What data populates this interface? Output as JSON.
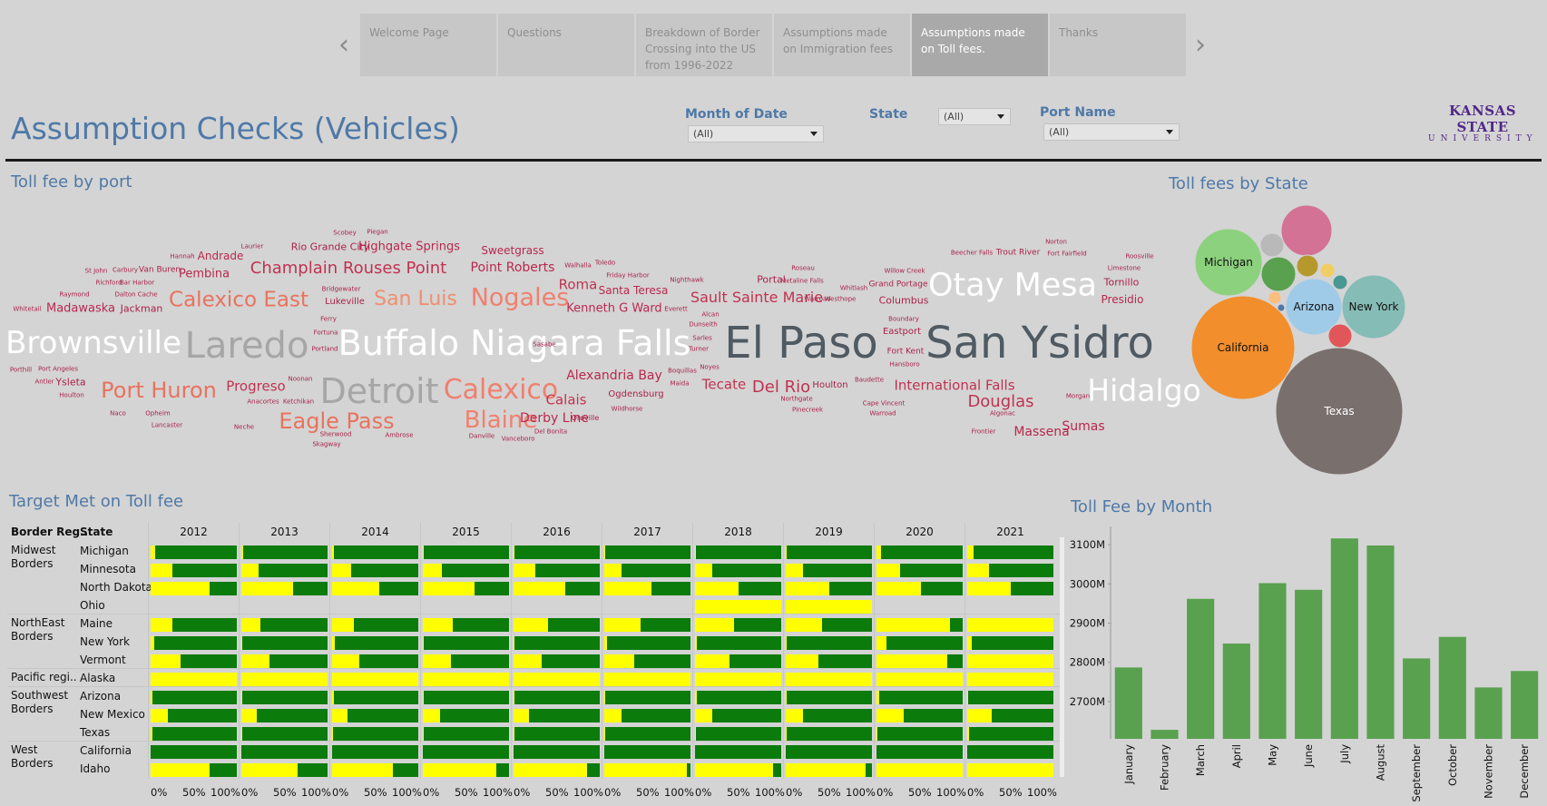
{
  "story": {
    "prev_arrow": "‹",
    "next_arrow": "›",
    "tabs": [
      {
        "label": "Welcome Page",
        "active": false
      },
      {
        "label": "Questions",
        "active": false
      },
      {
        "label": "Breakdown of Border Crossing into the US from 1996-2022",
        "active": false
      },
      {
        "label": "Assumptions made on Immigration fees",
        "active": false
      },
      {
        "label": "Assumptions made on Toll fees.",
        "active": true
      },
      {
        "label": "Thanks",
        "active": false
      }
    ]
  },
  "header": {
    "title": "Assumption Checks (Vehicles)",
    "logo_line1": "KANSAS STATE",
    "logo_line2": "UNIVERSITY"
  },
  "filters": {
    "month_label": "Month of Date",
    "month_value": "(All)",
    "state_label": "State",
    "state_value": "(All)",
    "port_label": "Port Name",
    "port_value": "(All)"
  },
  "wordcloud": {
    "title": "Toll fee by port",
    "words": [
      {
        "t": "Scobey",
        "s": 7,
        "c": "#a9224a"
      },
      {
        "t": "Piegan",
        "s": 7,
        "c": "#a9224a"
      },
      {
        "t": "Laurier",
        "s": 7,
        "c": "#a9224a"
      },
      {
        "t": "Rio Grande City",
        "s": 11,
        "c": "#a9224a"
      },
      {
        "t": "Highgate Springs",
        "s": 13,
        "c": "#b8284e"
      },
      {
        "t": "Sweetgrass",
        "s": 12,
        "c": "#b8284e"
      },
      {
        "t": "Hannah",
        "s": 7,
        "c": "#a9224a"
      },
      {
        "t": "Andrade",
        "s": 12,
        "c": "#b8284e"
      },
      {
        "t": "St John",
        "s": 7,
        "c": "#a9224a"
      },
      {
        "t": "Carbury",
        "s": 7,
        "c": "#a9224a"
      },
      {
        "t": "Van Buren",
        "s": 9,
        "c": "#a9224a"
      },
      {
        "t": "Pembina",
        "s": 13,
        "c": "#b8284e"
      },
      {
        "t": "Champlain Rouses Point",
        "s": 18,
        "c": "#bf3350"
      },
      {
        "t": "Point Roberts",
        "s": 14,
        "c": "#b8284e"
      },
      {
        "t": "Walhalla",
        "s": 7,
        "c": "#a9224a"
      },
      {
        "t": "Toledo",
        "s": 7,
        "c": "#a9224a"
      },
      {
        "t": "Friday Harbor",
        "s": 7,
        "c": "#a9224a"
      },
      {
        "t": "Roma",
        "s": 15,
        "c": "#bf3350"
      },
      {
        "t": "Santa Teresa",
        "s": 12,
        "c": "#b8284e"
      },
      {
        "t": "Richford",
        "s": 7,
        "c": "#a9224a"
      },
      {
        "t": "Bar Harbor",
        "s": 7,
        "c": "#a9224a"
      },
      {
        "t": "Raymond",
        "s": 7,
        "c": "#a9224a"
      },
      {
        "t": "Dalton Cache",
        "s": 7,
        "c": "#a9224a"
      },
      {
        "t": "Calexico East",
        "s": 23,
        "c": "#e8735e"
      },
      {
        "t": "Bridgewater",
        "s": 7,
        "c": "#a9224a"
      },
      {
        "t": "Lukeville",
        "s": 10,
        "c": "#a9224a"
      },
      {
        "t": "San Luis",
        "s": 22,
        "c": "#ef8f6f"
      },
      {
        "t": "Nogales",
        "s": 27,
        "c": "#ef8070"
      },
      {
        "t": "Whitetail",
        "s": 7,
        "c": "#a9224a"
      },
      {
        "t": "Madawaska",
        "s": 13,
        "c": "#b8284e"
      },
      {
        "t": "Jackman",
        "s": 11,
        "c": "#a9224a"
      },
      {
        "t": "Kenneth G Ward",
        "s": 13,
        "c": "#b8284e"
      },
      {
        "t": "Everett",
        "s": 7,
        "c": "#a9224a"
      },
      {
        "t": "Ferry",
        "s": 7,
        "c": "#a9224a"
      },
      {
        "t": "Brownsville",
        "s": 34,
        "c": "#ffffff"
      },
      {
        "t": "Fortuna",
        "s": 7,
        "c": "#a9224a"
      },
      {
        "t": "Portland",
        "s": 7,
        "c": "#a9224a"
      },
      {
        "t": "Laredo",
        "s": 40,
        "c": "#a6a6a6"
      },
      {
        "t": "Buffalo Niagara Falls",
        "s": 38,
        "c": "#ffffff"
      },
      {
        "t": "El Paso",
        "s": 48,
        "c": "#4f5a62"
      },
      {
        "t": "San Ysidro",
        "s": 48,
        "c": "#4f5a62"
      },
      {
        "t": "Nighthawk",
        "s": 7,
        "c": "#a9224a"
      },
      {
        "t": "Alcan",
        "s": 7,
        "c": "#a9224a"
      },
      {
        "t": "Dunseith",
        "s": 7,
        "c": "#a9224a"
      },
      {
        "t": "Sault Sainte Marie",
        "s": 16,
        "c": "#bf3350"
      },
      {
        "t": "Portal",
        "s": 11,
        "c": "#a9224a"
      },
      {
        "t": "Roseau",
        "s": 7,
        "c": "#a9224a"
      },
      {
        "t": "Metaline Falls",
        "s": 7,
        "c": "#a9224a"
      },
      {
        "t": "Whitlash",
        "s": 7,
        "c": "#a9224a"
      },
      {
        "t": "Warroad",
        "s": 7,
        "c": "#a9224a"
      },
      {
        "t": "Westhope",
        "s": 7,
        "c": "#a9224a"
      },
      {
        "t": "Willow Creek",
        "s": 7,
        "c": "#a9224a"
      },
      {
        "t": "Grand Portage",
        "s": 9,
        "c": "#a9224a"
      },
      {
        "t": "Columbus",
        "s": 11,
        "c": "#a9224a"
      },
      {
        "t": "Otay Mesa",
        "s": 35,
        "c": "#ffffff"
      },
      {
        "t": "Beecher Falls",
        "s": 7,
        "c": "#a9224a"
      },
      {
        "t": "Trout River",
        "s": 9,
        "c": "#a9224a"
      },
      {
        "t": "Norton",
        "s": 7,
        "c": "#a9224a"
      },
      {
        "t": "Fort Fairfield",
        "s": 7,
        "c": "#a9224a"
      },
      {
        "t": "Roosville",
        "s": 7,
        "c": "#a9224a"
      },
      {
        "t": "Limestone",
        "s": 7,
        "c": "#a9224a"
      },
      {
        "t": "Tornillo",
        "s": 11,
        "c": "#a9224a"
      },
      {
        "t": "Presidio",
        "s": 12,
        "c": "#b8284e"
      },
      {
        "t": "Boundary",
        "s": 7,
        "c": "#a9224a"
      },
      {
        "t": "Eastport",
        "s": 10,
        "c": "#a9224a"
      },
      {
        "t": "Fort Kent",
        "s": 9,
        "c": "#a9224a"
      },
      {
        "t": "Hansboro",
        "s": 7,
        "c": "#a9224a"
      },
      {
        "t": "Porthill",
        "s": 7,
        "c": "#a9224a"
      },
      {
        "t": "Port Angeles",
        "s": 7,
        "c": "#a9224a"
      },
      {
        "t": "Antler",
        "s": 7,
        "c": "#a9224a"
      },
      {
        "t": "Ysleta",
        "s": 11,
        "c": "#a9224a"
      },
      {
        "t": "Houlton",
        "s": 7,
        "c": "#a9224a"
      },
      {
        "t": "Port Huron",
        "s": 24,
        "c": "#e8735e"
      },
      {
        "t": "Progreso",
        "s": 15,
        "c": "#bf3350"
      },
      {
        "t": "Noonan",
        "s": 7,
        "c": "#a9224a"
      },
      {
        "t": "Anacortes",
        "s": 7,
        "c": "#a9224a"
      },
      {
        "t": "Ketchikan",
        "s": 7,
        "c": "#a9224a"
      },
      {
        "t": "Detroit",
        "s": 38,
        "c": "#a6a6a6"
      },
      {
        "t": "Calexico",
        "s": 30,
        "c": "#ef8070"
      },
      {
        "t": "Alexandria Bay",
        "s": 14,
        "c": "#b8284e"
      },
      {
        "t": "Calais",
        "s": 15,
        "c": "#bf3350"
      },
      {
        "t": "Ogdensburg",
        "s": 10,
        "c": "#a9224a"
      },
      {
        "t": "Wildhorse",
        "s": 7,
        "c": "#a9224a"
      },
      {
        "t": "Boquillas",
        "s": 7,
        "c": "#a9224a"
      },
      {
        "t": "Maida",
        "s": 7,
        "c": "#a9224a"
      },
      {
        "t": "Sarles",
        "s": 7,
        "c": "#a9224a"
      },
      {
        "t": "Turner",
        "s": 7,
        "c": "#a9224a"
      },
      {
        "t": "Noyes",
        "s": 7,
        "c": "#a9224a"
      },
      {
        "t": "Tecate",
        "s": 15,
        "c": "#bf3350"
      },
      {
        "t": "Del Rio",
        "s": 18,
        "c": "#bf3350"
      },
      {
        "t": "Houlton",
        "s": 10,
        "c": "#a9224a"
      },
      {
        "t": "Northgate",
        "s": 7,
        "c": "#a9224a"
      },
      {
        "t": "Pinecreek",
        "s": 7,
        "c": "#a9224a"
      },
      {
        "t": "Baudette",
        "s": 7,
        "c": "#a9224a"
      },
      {
        "t": "International Falls",
        "s": 15,
        "c": "#bf3350"
      },
      {
        "t": "Cape Vincent",
        "s": 7,
        "c": "#a9224a"
      },
      {
        "t": "Warroad",
        "s": 7,
        "c": "#a9224a"
      },
      {
        "t": "Douglas",
        "s": 18,
        "c": "#bf3350"
      },
      {
        "t": "Algonac",
        "s": 7,
        "c": "#a9224a"
      },
      {
        "t": "Morgan",
        "s": 7,
        "c": "#a9224a"
      },
      {
        "t": "Hidalgo",
        "s": 33,
        "c": "#ffffff"
      },
      {
        "t": "Naco",
        "s": 7,
        "c": "#a9224a"
      },
      {
        "t": "Opheim",
        "s": 7,
        "c": "#a9224a"
      },
      {
        "t": "Lancaster",
        "s": 7,
        "c": "#a9224a"
      },
      {
        "t": "Neche",
        "s": 7,
        "c": "#a9224a"
      },
      {
        "t": "Eagle Pass",
        "s": 24,
        "c": "#e8735e"
      },
      {
        "t": "Sherwood",
        "s": 7,
        "c": "#a9224a"
      },
      {
        "t": "Skagway",
        "s": 7,
        "c": "#a9224a"
      },
      {
        "t": "Ambrose",
        "s": 7,
        "c": "#a9224a"
      },
      {
        "t": "Blaine",
        "s": 26,
        "c": "#ef8070"
      },
      {
        "t": "Derby Line",
        "s": 14,
        "c": "#b8284e"
      },
      {
        "t": "Oroville",
        "s": 8,
        "c": "#a9224a"
      },
      {
        "t": "Danville",
        "s": 7,
        "c": "#a9224a"
      },
      {
        "t": "Vanceboro",
        "s": 7,
        "c": "#a9224a"
      },
      {
        "t": "Del Bonita",
        "s": 7,
        "c": "#a9224a"
      },
      {
        "t": "Frontier",
        "s": 7,
        "c": "#a9224a"
      },
      {
        "t": "Massena",
        "s": 14,
        "c": "#b8284e"
      },
      {
        "t": "Sumas",
        "s": 14,
        "c": "#b8284e"
      },
      {
        "t": "Sasabe",
        "s": 7,
        "c": "#a9224a"
      }
    ]
  },
  "bubbles": {
    "title": "Toll fees by State",
    "items": [
      {
        "label": "Michigan",
        "color": "#8cd17d"
      },
      {
        "label": "",
        "color": "#b9b9b9"
      },
      {
        "label": "",
        "color": "#d37295"
      },
      {
        "label": "",
        "color": "#59a14f"
      },
      {
        "label": "",
        "color": "#b6992d"
      },
      {
        "label": "",
        "color": "#f1ce63"
      },
      {
        "label": "",
        "color": "#499894"
      },
      {
        "label": "",
        "color": "#ffbe7d"
      },
      {
        "label": "",
        "color": "#4e79a7"
      },
      {
        "label": "Arizona",
        "color": "#a0cbe8"
      },
      {
        "label": "New York",
        "color": "#86bcb6"
      },
      {
        "label": "California",
        "color": "#f28e2b"
      },
      {
        "label": "",
        "color": "#e15759"
      },
      {
        "label": "Texas",
        "color": "#79706e"
      }
    ]
  },
  "target_table": {
    "title": "Target Met on Toll fee",
    "col_region": "Border Reg..",
    "col_state": "State",
    "years": [
      "2012",
      "2013",
      "2014",
      "2015",
      "2016",
      "2017",
      "2018",
      "2019",
      "2020",
      "2021"
    ],
    "axis_ticks": [
      "0%",
      "50%",
      "100%"
    ],
    "colors": {
      "not_met": "#ffff00",
      "met": "#0b7b0b"
    },
    "regions": [
      {
        "label": "Midwest Borders",
        "rows": 4
      },
      {
        "label": "NorthEast Borders",
        "rows": 3
      },
      {
        "label": "Pacific regi..",
        "rows": 1
      },
      {
        "label": "Southwest Borders",
        "rows": 3
      },
      {
        "label": "West Borders",
        "rows": 2
      }
    ],
    "rows": [
      {
        "state": "Michigan",
        "values": [
          0.05,
          0.02,
          0.02,
          0.01,
          0.01,
          0.01,
          0.01,
          0.01,
          0.05,
          0.07
        ]
      },
      {
        "state": "Minnesota",
        "values": [
          0.25,
          0.2,
          0.22,
          0.22,
          0.25,
          0.2,
          0.2,
          0.2,
          0.27,
          0.25
        ]
      },
      {
        "state": "North Dakota",
        "values": [
          0.68,
          0.6,
          0.55,
          0.6,
          0.6,
          0.55,
          0.5,
          0.5,
          0.52,
          0.5
        ]
      },
      {
        "state": "Ohio",
        "values": [
          null,
          null,
          null,
          null,
          null,
          null,
          1.0,
          1.0,
          null,
          null
        ]
      },
      {
        "state": "Maine",
        "values": [
          0.25,
          0.22,
          0.25,
          0.35,
          0.4,
          0.42,
          0.45,
          0.42,
          0.85,
          1.0
        ]
      },
      {
        "state": "New York",
        "values": [
          0.04,
          0.01,
          0.03,
          0.01,
          0.01,
          0.03,
          0.02,
          0.01,
          0.12,
          0.05
        ]
      },
      {
        "state": "Vermont",
        "values": [
          0.35,
          0.33,
          0.32,
          0.33,
          0.33,
          0.35,
          0.4,
          0.38,
          0.82,
          1.0
        ]
      },
      {
        "state": "Alaska",
        "values": [
          1.0,
          1.0,
          1.0,
          1.0,
          1.0,
          1.0,
          1.0,
          1.0,
          1.0,
          1.0
        ]
      },
      {
        "state": "Arizona",
        "values": [
          0.02,
          0.01,
          0.02,
          0.01,
          0.01,
          0.01,
          0.02,
          0.01,
          0.03,
          0.01
        ]
      },
      {
        "state": "New Mexico",
        "values": [
          0.2,
          0.18,
          0.18,
          0.2,
          0.18,
          0.2,
          0.2,
          0.2,
          0.32,
          0.28
        ]
      },
      {
        "state": "Texas",
        "values": [
          0.02,
          0.01,
          0.01,
          0.01,
          0.01,
          0.01,
          0.01,
          0.01,
          0.01,
          0.02
        ]
      },
      {
        "state": "California",
        "values": [
          0.0,
          0.0,
          0.0,
          0.0,
          0.0,
          0.0,
          0.0,
          0.0,
          0.0,
          0.0
        ]
      },
      {
        "state": "Idaho",
        "values": [
          0.68,
          0.65,
          0.7,
          0.85,
          0.85,
          0.96,
          0.9,
          0.93,
          1.0,
          1.0
        ]
      }
    ]
  },
  "chart_data": {
    "type": "bar",
    "title": "Toll Fee by Month",
    "categories": [
      "January",
      "February",
      "March",
      "April",
      "May",
      "June",
      "July",
      "August",
      "September",
      "October",
      "November",
      "December"
    ],
    "values": [
      2787,
      2628,
      2962,
      2848,
      3002,
      2985,
      3116,
      3098,
      2810,
      2865,
      2736,
      2778
    ],
    "yticks": [
      "3100M",
      "3000M",
      "2900M",
      "2800M",
      "2700M"
    ],
    "ytick_values": [
      3100,
      3000,
      2900,
      2800,
      2700
    ],
    "ylim": [
      2605,
      3135
    ],
    "color": "#59a14f",
    "xlabel": "",
    "ylabel": ""
  }
}
